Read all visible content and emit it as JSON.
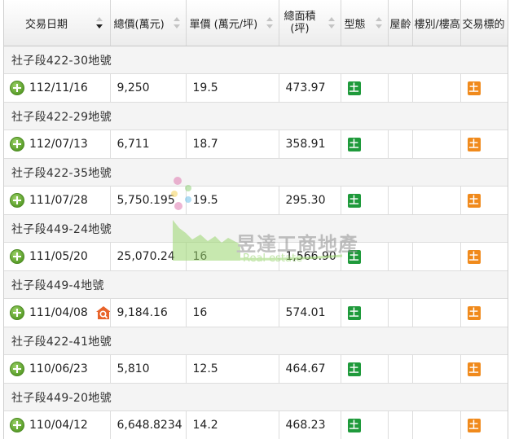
{
  "columns": [
    {
      "label": "交易日期",
      "sort": "active-desc"
    },
    {
      "label": "總價(萬元)",
      "sort": "none"
    },
    {
      "label": "單價 (萬元/坪)",
      "sort": "none"
    },
    {
      "label_line1": "總面積",
      "label_line2": "(坪)",
      "sort": "none"
    },
    {
      "label": "型態",
      "sort": "none"
    },
    {
      "label": "屋齡"
    },
    {
      "label": "樓別/樓高"
    },
    {
      "label": "交易標的"
    }
  ],
  "groups": [
    {
      "title": "社子段422-30地號",
      "row": {
        "date": "112/11/16",
        "total": "9,250",
        "unit": "19.5",
        "area": "473.97",
        "type": "土",
        "age": "",
        "floor": "",
        "target": "土",
        "search_icon": false
      }
    },
    {
      "title": "社子段422-29地號",
      "row": {
        "date": "112/07/13",
        "total": "6,711",
        "unit": "18.7",
        "area": "358.91",
        "type": "土",
        "age": "",
        "floor": "",
        "target": "土",
        "search_icon": false
      }
    },
    {
      "title": "社子段422-35地號",
      "row": {
        "date": "111/07/28",
        "total": "5,750.195",
        "unit": "19.5",
        "area": "295.30",
        "type": "土",
        "age": "",
        "floor": "",
        "target": "土",
        "search_icon": false
      }
    },
    {
      "title": "社子段449-24地號",
      "row": {
        "date": "111/05/20",
        "total": "25,070.24",
        "unit": "16",
        "area": "1,566.90",
        "type": "土",
        "age": "",
        "floor": "",
        "target": "土",
        "search_icon": false
      }
    },
    {
      "title": "社子段449-4地號",
      "row": {
        "date": "111/04/08",
        "total": "9,184.16",
        "unit": "16",
        "area": "574.01",
        "type": "土",
        "age": "",
        "floor": "",
        "target": "土",
        "search_icon": true
      }
    },
    {
      "title": "社子段422-41地號",
      "row": {
        "date": "110/06/23",
        "total": "5,810",
        "unit": "12.5",
        "area": "464.67",
        "type": "土",
        "age": "",
        "floor": "",
        "target": "土",
        "search_icon": false
      }
    },
    {
      "title": "社子段449-20地號",
      "row": {
        "date": "110/04/12",
        "total": "6,648.8234",
        "unit": "14.2",
        "area": "468.23",
        "type": "土",
        "age": "",
        "floor": "",
        "target": "土",
        "search_icon": false
      }
    }
  ],
  "watermark": {
    "name": "昱達工商地產",
    "subtitle": "Real estate"
  },
  "colors": {
    "type_badge": "#1f9a3b",
    "target_badge": "#f08a1c",
    "expand_icon": "#5a9e2a",
    "search_icon": "#e8632a"
  }
}
